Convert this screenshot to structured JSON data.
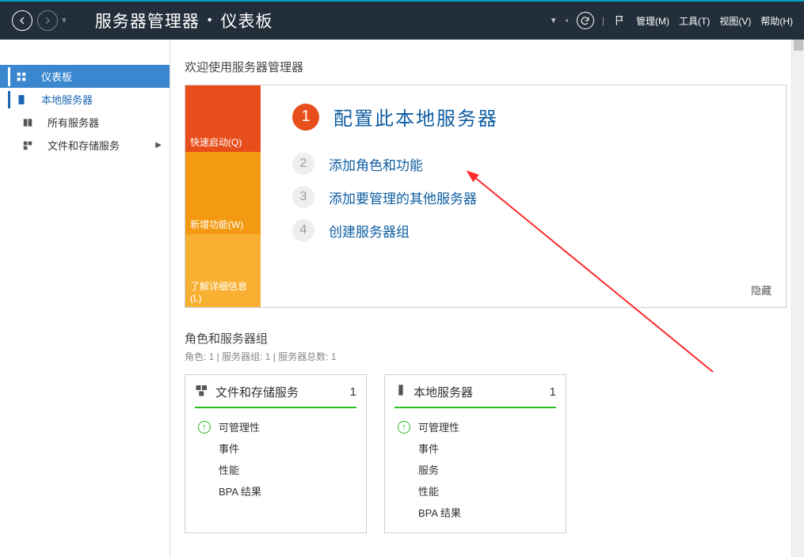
{
  "header": {
    "app_title": "服务器管理器",
    "page_title": "仪表板",
    "menus": {
      "manage": "管理(M)",
      "tools": "工具(T)",
      "view": "视图(V)",
      "help": "帮助(H)"
    }
  },
  "sidebar": {
    "items": [
      {
        "label": "仪表板",
        "icon": "dashboard",
        "active": true
      },
      {
        "label": "本地服务器",
        "icon": "server",
        "highlight": true
      },
      {
        "label": "所有服务器",
        "icon": "servers"
      },
      {
        "label": "文件和存储服务",
        "icon": "storage",
        "has_children": true
      }
    ]
  },
  "main": {
    "welcome_heading": "欢迎使用服务器管理器",
    "orange_labels": {
      "quickstart": "快速启动(Q)",
      "whatsnew": "新增功能(W)",
      "learnmore": "了解详细信息(L)"
    },
    "steps": [
      {
        "n": "1",
        "text": "配置此本地服务器",
        "big": true
      },
      {
        "n": "2",
        "text": "添加角色和功能"
      },
      {
        "n": "3",
        "text": "添加要管理的其他服务器"
      },
      {
        "n": "4",
        "text": "创建服务器组"
      }
    ],
    "hide": "隐藏",
    "roles": {
      "title": "角色和服务器组",
      "subtitle": "角色: 1 | 服务器组: 1 | 服务器总数: 1",
      "tiles": [
        {
          "title": "文件和存储服务",
          "count": "1",
          "rows": [
            {
              "icon": "up",
              "text": "可管理性"
            },
            {
              "text": "事件"
            },
            {
              "text": "性能"
            },
            {
              "text": "BPA 结果"
            }
          ]
        },
        {
          "title": "本地服务器",
          "count": "1",
          "rows": [
            {
              "icon": "up",
              "text": "可管理性"
            },
            {
              "text": "事件"
            },
            {
              "text": "服务"
            },
            {
              "text": "性能"
            },
            {
              "text": "BPA 结果"
            }
          ]
        }
      ]
    }
  }
}
